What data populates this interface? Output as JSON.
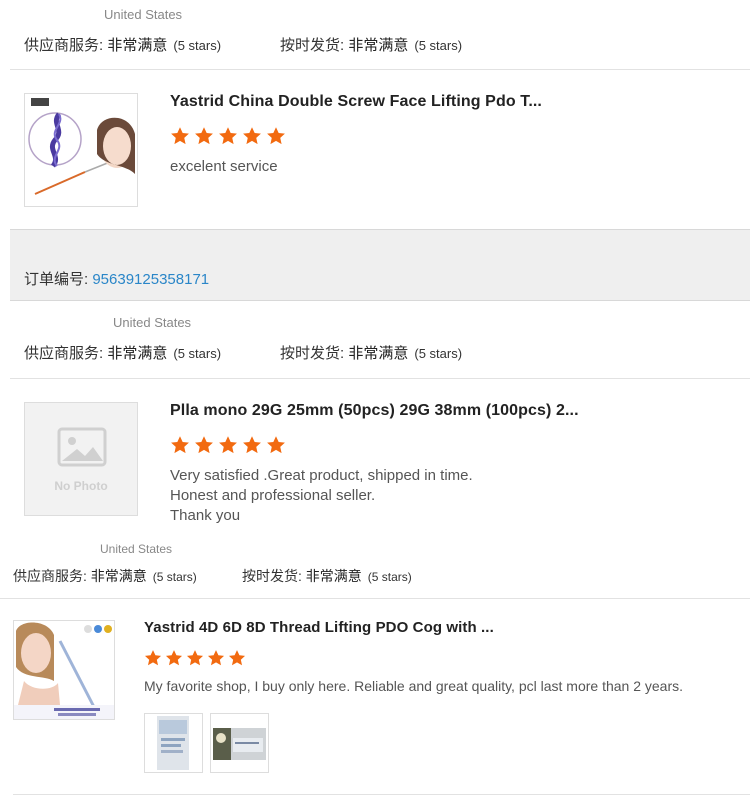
{
  "reviews": [
    {
      "country": "United States",
      "supplier_service_label": "供应商服务:",
      "supplier_service_value": "非常满意",
      "supplier_service_stars": "(5 stars)",
      "ontime_label": "按时发货:",
      "ontime_value": "非常满意",
      "ontime_stars": "(5 stars)",
      "product_title": "Yastrid China Double Screw Face Lifting Pdo T...",
      "rating": 5,
      "comment": [
        "excelent service"
      ]
    },
    {
      "order_label": "订单编号:",
      "order_number": "95639125358171",
      "country": "United States",
      "supplier_service_label": "供应商服务:",
      "supplier_service_value": "非常满意",
      "supplier_service_stars": "(5 stars)",
      "ontime_label": "按时发货:",
      "ontime_value": "非常满意",
      "ontime_stars": "(5 stars)",
      "product_title": "Plla mono 29G 25mm (50pcs) 29G 38mm (100pcs) 2...",
      "no_photo_text": "No Photo",
      "rating": 5,
      "comment": [
        "Very satisfied .Great product, shipped in time.",
        "Honest and professional seller.",
        "Thank you"
      ]
    },
    {
      "country": "United States",
      "supplier_service_label": "供应商服务:",
      "supplier_service_value": "非常满意",
      "supplier_service_stars": "(5 stars)",
      "ontime_label": "按时发货:",
      "ontime_value": "非常满意",
      "ontime_stars": "(5 stars)",
      "product_title": "Yastrid 4D 6D 8D Thread Lifting PDO Cog with ...",
      "rating": 5,
      "comment": [
        "My favorite shop, I buy only here. Reliable and great quality, pcl last more than 2 years."
      ]
    }
  ],
  "colors": {
    "star": "#f26a10",
    "link": "#2a86c8"
  }
}
